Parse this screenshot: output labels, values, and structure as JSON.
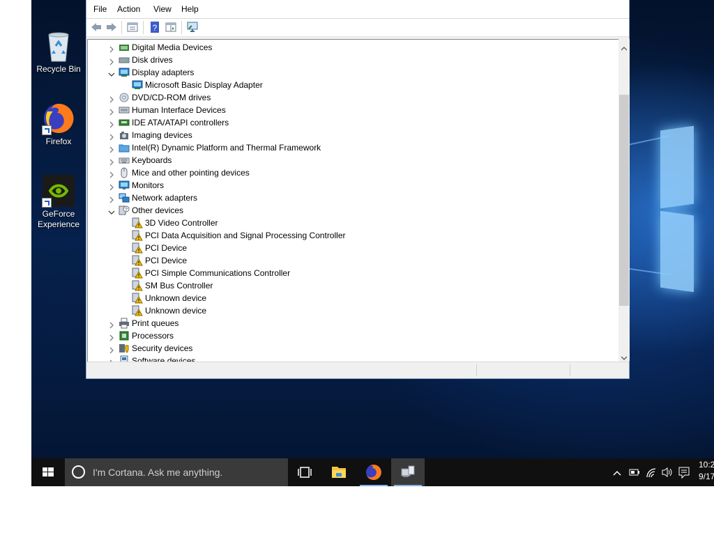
{
  "desktop": {
    "icons": [
      {
        "label": "Recycle Bin"
      },
      {
        "label": "Firefox"
      },
      {
        "label": "GeForce Experience"
      }
    ]
  },
  "window": {
    "menus": [
      "File",
      "Action",
      "View",
      "Help"
    ],
    "toolbar_icons": [
      "back-icon",
      "forward-icon",
      "properties-icon",
      "help-icon",
      "show-hide-icon",
      "scan-hardware-icon"
    ],
    "tree": [
      {
        "label": "Digital Media Devices",
        "icon": "media-icon",
        "expanded": false
      },
      {
        "label": "Disk drives",
        "icon": "disk-icon",
        "expanded": false
      },
      {
        "label": "Display adapters",
        "icon": "display-adapter-icon",
        "expanded": true
      },
      {
        "label": "Microsoft Basic Display Adapter",
        "icon": "display-adapter-icon",
        "child": true
      },
      {
        "label": "DVD/CD-ROM drives",
        "icon": "dvd-icon",
        "expanded": false
      },
      {
        "label": "Human Interface Devices",
        "icon": "hid-icon",
        "expanded": false
      },
      {
        "label": "IDE ATA/ATAPI controllers",
        "icon": "ide-icon",
        "expanded": false
      },
      {
        "label": "Imaging devices",
        "icon": "camera-icon",
        "expanded": false
      },
      {
        "label": "Intel(R) Dynamic Platform and Thermal Framework",
        "icon": "folder-icon",
        "expanded": false
      },
      {
        "label": "Keyboards",
        "icon": "keyboard-icon",
        "expanded": false
      },
      {
        "label": "Mice and other pointing devices",
        "icon": "mouse-icon",
        "expanded": false
      },
      {
        "label": "Monitors",
        "icon": "monitor-icon",
        "expanded": false
      },
      {
        "label": "Network adapters",
        "icon": "network-icon",
        "expanded": false
      },
      {
        "label": "Other devices",
        "icon": "unknown-device-icon",
        "expanded": true
      },
      {
        "label": "3D Video Controller",
        "icon": "warning-device-icon",
        "child": true
      },
      {
        "label": "PCI Data Acquisition and Signal Processing Controller",
        "icon": "warning-device-icon",
        "child": true
      },
      {
        "label": "PCI Device",
        "icon": "warning-device-icon",
        "child": true
      },
      {
        "label": "PCI Device",
        "icon": "warning-device-icon",
        "child": true
      },
      {
        "label": "PCI Simple Communications Controller",
        "icon": "warning-device-icon",
        "child": true
      },
      {
        "label": "SM Bus Controller",
        "icon": "warning-device-icon",
        "child": true
      },
      {
        "label": "Unknown device",
        "icon": "warning-device-icon",
        "child": true
      },
      {
        "label": "Unknown device",
        "icon": "warning-device-icon",
        "child": true
      },
      {
        "label": "Print queues",
        "icon": "printer-icon",
        "expanded": false
      },
      {
        "label": "Processors",
        "icon": "processor-icon",
        "expanded": false
      },
      {
        "label": "Security devices",
        "icon": "security-icon",
        "expanded": false
      },
      {
        "label": "Software devices",
        "icon": "software-icon",
        "expanded": false
      }
    ]
  },
  "taskbar": {
    "search_placeholder": "I'm Cortana. Ask me anything.",
    "clock_time": "10:2",
    "clock_date": "9/17"
  },
  "colors": {
    "accent": "#7fb1e6",
    "warning": "#f5c000",
    "taskbar": "#101010"
  }
}
